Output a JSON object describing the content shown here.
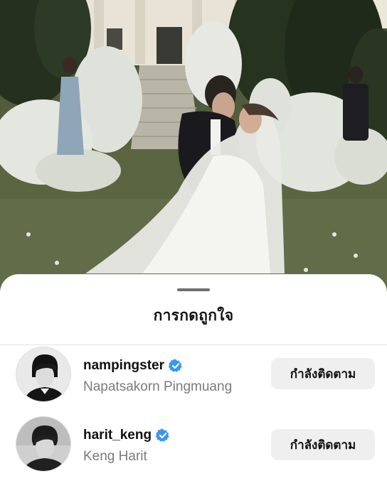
{
  "sheet": {
    "title": "การกดถูกใจ"
  },
  "users": [
    {
      "username": "nampingster",
      "full_name": "Napatsakorn Pingmuang",
      "verified": true,
      "button_label": "กำลังติดตาม"
    },
    {
      "username": "harit_keng",
      "full_name": "Keng Harit",
      "verified": true,
      "button_label": "กำลังติดตาม"
    }
  ],
  "colors": {
    "verified_badge": "#3897f0",
    "button_bg": "#efefef",
    "secondary_text": "#7b7b7b"
  },
  "icons": {
    "verified": "verified-badge-icon"
  }
}
